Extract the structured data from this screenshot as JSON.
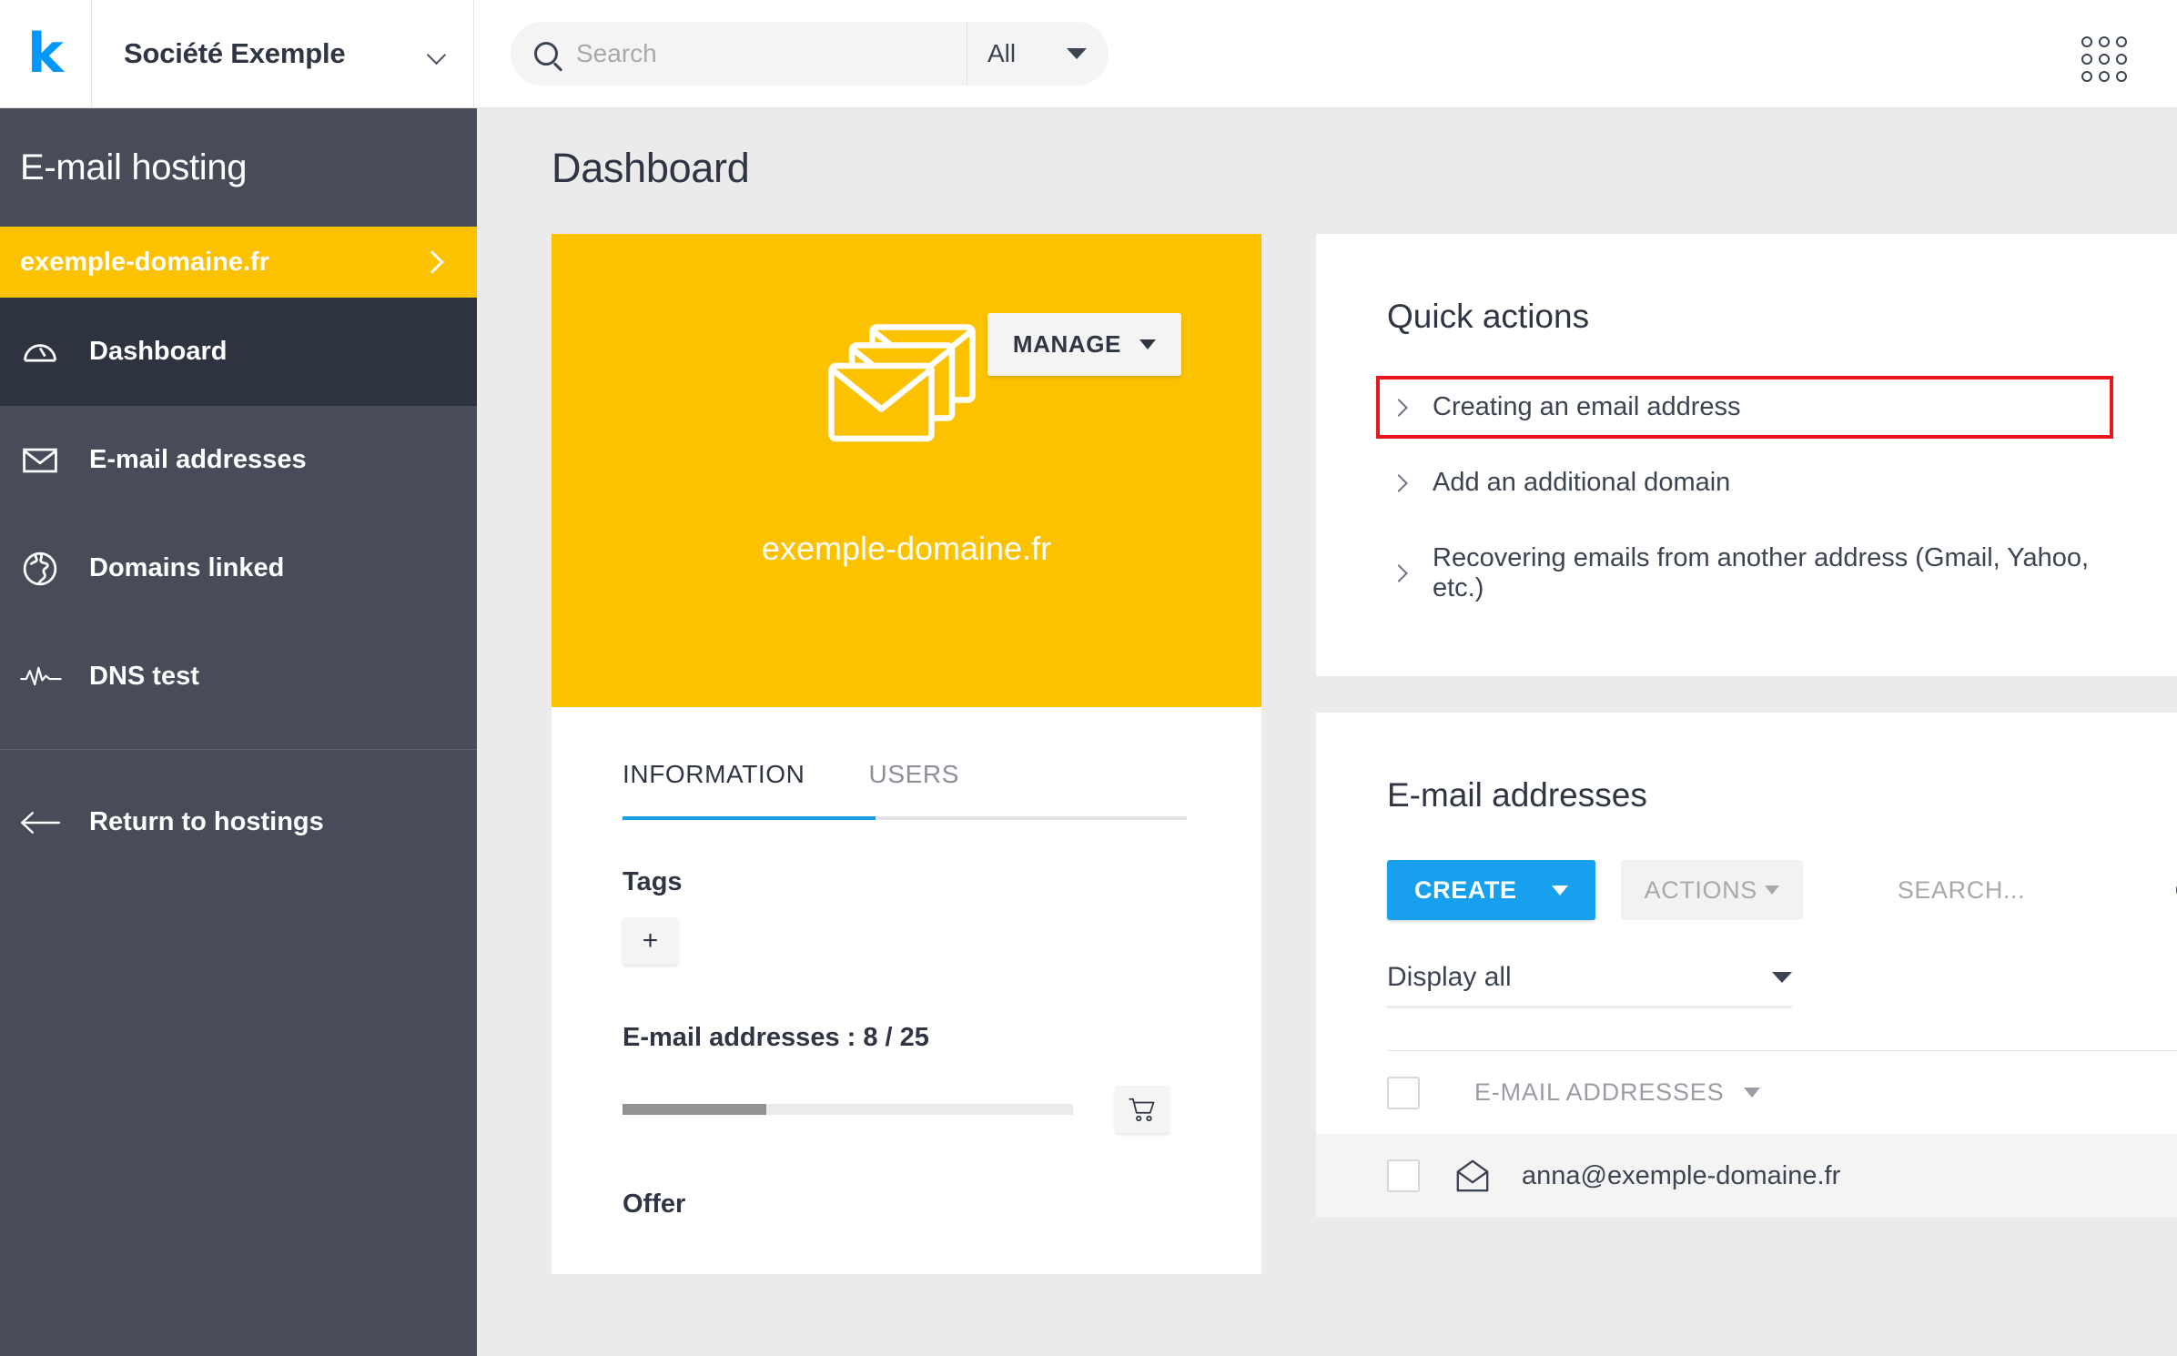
{
  "topbar": {
    "logo": "k",
    "org_name": "Société Exemple",
    "search_placeholder": "Search",
    "search_value": "",
    "search_filter": "All",
    "apps_icon": "apps-grid-icon"
  },
  "sidebar": {
    "title": "E-mail hosting",
    "domain": "exemple-domaine.fr",
    "items": [
      {
        "label": "Dashboard",
        "icon": "gauge-icon",
        "active": true
      },
      {
        "label": "E-mail addresses",
        "icon": "envelope-icon",
        "active": false
      },
      {
        "label": "Domains linked",
        "icon": "globe-icon",
        "active": false
      },
      {
        "label": "DNS test",
        "icon": "pulse-icon",
        "active": false
      }
    ],
    "return_label": "Return to hostings",
    "return_icon": "arrow-left-icon"
  },
  "main": {
    "page_title": "Dashboard",
    "hero": {
      "manage_label": "MANAGE",
      "domain": "exemple-domaine.fr",
      "icon": "stacked-envelopes-icon",
      "background_color": "#fcc200"
    },
    "info_card": {
      "tabs": [
        {
          "label": "INFORMATION",
          "active": true
        },
        {
          "label": "USERS",
          "active": false
        }
      ],
      "tags_label": "Tags",
      "tag_add_label": "+",
      "quota_label": "E-mail addresses : 8 / 25",
      "quota_used": 8,
      "quota_total": 25,
      "quota_percent": 32,
      "cart_icon": "shopping-cart-icon",
      "offer_label": "Offer"
    },
    "quick_actions": {
      "title": "Quick actions",
      "items": [
        {
          "label": "Creating an email address",
          "highlighted": true
        },
        {
          "label": "Add an additional domain",
          "highlighted": false
        },
        {
          "label": "Recovering emails from another address (Gmail, Yahoo, etc.)",
          "highlighted": false
        }
      ],
      "highlight_color": "#e8151a"
    },
    "emails_card": {
      "title": "E-mail addresses",
      "create_label": "CREATE",
      "actions_label": "ACTIONS",
      "search_placeholder": "SEARCH...",
      "search_value": "",
      "display_filter": "Display all",
      "column_header": "E-MAIL ADDRESSES",
      "rows": [
        {
          "address": "anna@exemple-domaine.fr",
          "icon": "open-envelope-icon",
          "checked": false
        }
      ]
    }
  },
  "colors": {
    "accent_yellow": "#fcc200",
    "accent_blue": "#17a0ee",
    "sidebar": "#474c58",
    "sidebar_active": "#2e3340",
    "logo_blue": "#0098ff"
  }
}
